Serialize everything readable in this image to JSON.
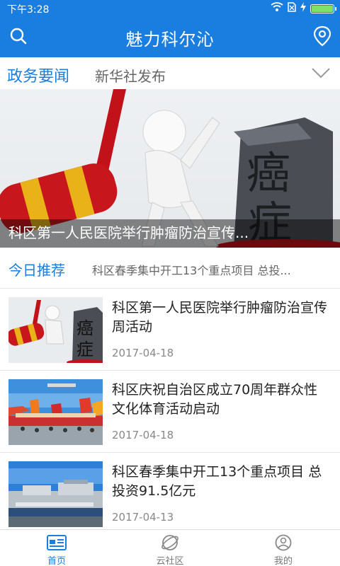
{
  "status": {
    "time": "下午3:28"
  },
  "app": {
    "title": "魅力科尔沁"
  },
  "section": {
    "active_tab": "政务要闻",
    "other_tab": "新华社发布"
  },
  "banner": {
    "caption": "科区第一人民医院举行肿瘤防治宣传..."
  },
  "today": {
    "label": "今日推荐",
    "ticker": "科区春季集中开工13个重点项目 总投..."
  },
  "news": [
    {
      "headline": "科区第一人民医院举行肿瘤防治宣传周活动",
      "date": "2017-04-18"
    },
    {
      "headline": "科区庆祝自治区成立70周年群众性文化体育活动启动",
      "date": "2017-04-18"
    },
    {
      "headline": "科区春季集中开工13个重点项目 总投资91.5亿元",
      "date": "2017-04-13"
    }
  ],
  "nav": [
    {
      "label": "首页",
      "icon": "news-icon"
    },
    {
      "label": "云社区",
      "icon": "community-icon"
    },
    {
      "label": "我的",
      "icon": "profile-icon"
    }
  ],
  "colors": {
    "primary": "#1a7de0",
    "battery": "#7fe06a"
  }
}
